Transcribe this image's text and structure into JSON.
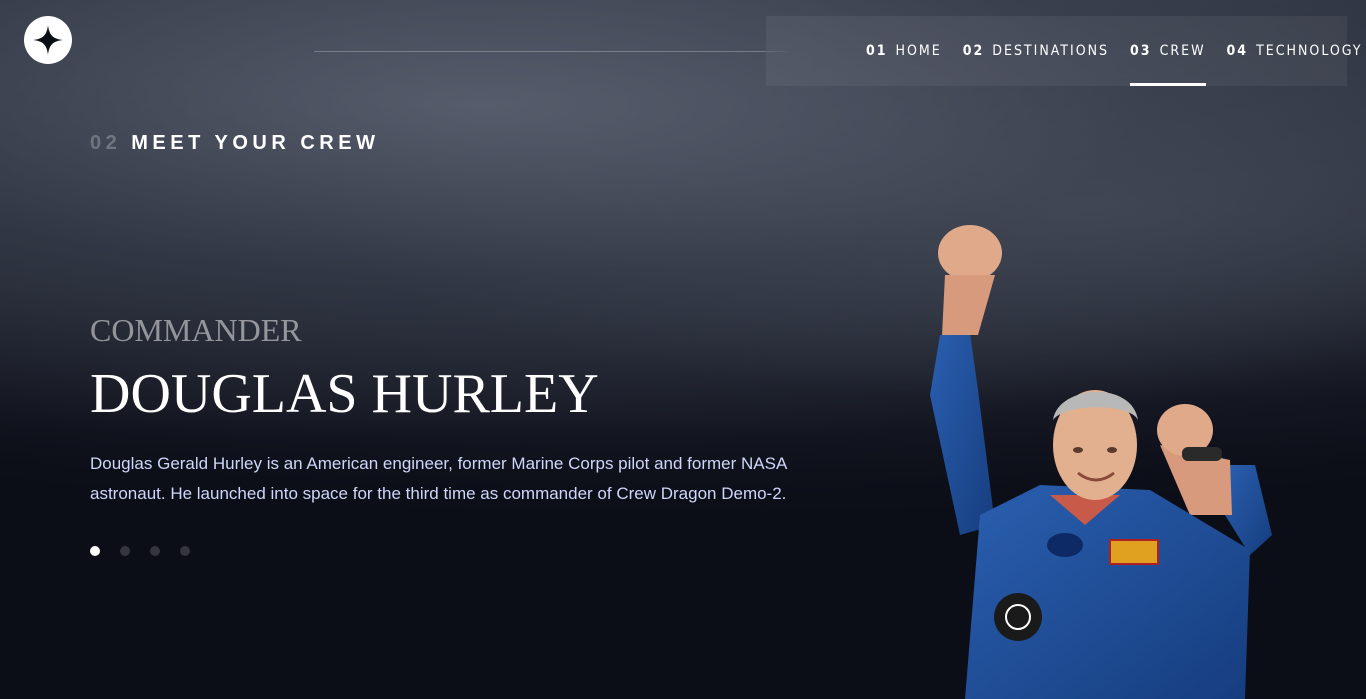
{
  "header": {
    "logo_icon": "star-logo-icon",
    "nav": [
      {
        "num": "01",
        "label": "HOME",
        "active": false
      },
      {
        "num": "02",
        "label": "DESTINATIONS",
        "active": false
      },
      {
        "num": "03",
        "label": "CREW",
        "active": true
      },
      {
        "num": "04",
        "label": "TECHNOLOGY",
        "active": false
      }
    ]
  },
  "page": {
    "heading_num": "02",
    "heading_text": "MEET YOUR CREW"
  },
  "crew": {
    "role": "COMMANDER",
    "name": "DOUGLAS HURLEY",
    "bio": "Douglas Gerald Hurley is an American engineer, former Marine Corps pilot and former NASA astronaut. He launched into space for the third time as commander of Crew Dragon Demo-2.",
    "image_icon": "astronaut-portrait",
    "slides_total": 4,
    "active_slide": 1
  },
  "colors": {
    "background": "#0b0d17",
    "text_light": "#d0d6f9",
    "suit_blue": "#1f4f9c"
  }
}
